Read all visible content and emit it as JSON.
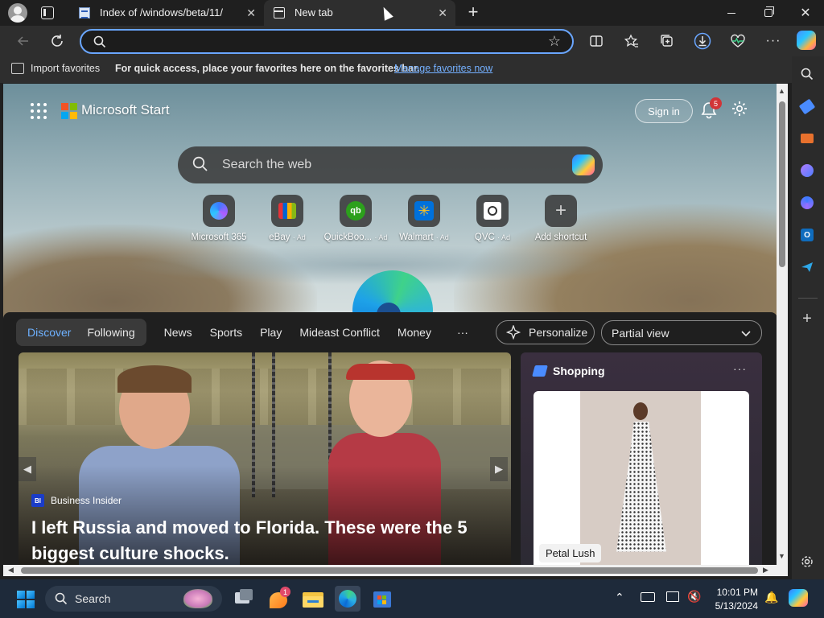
{
  "tabs": [
    {
      "title": "Index of /windows/beta/11/",
      "active": false
    },
    {
      "title": "New tab",
      "active": true
    }
  ],
  "address": {
    "value": "",
    "placeholder": ""
  },
  "favorites_bar": {
    "import_label": "Import favorites",
    "hint": "For quick access, place your favorites here on the favorites bar.",
    "manage_link": "Manage favorites now"
  },
  "page": {
    "brand": "Microsoft Start",
    "sign_in": "Sign in",
    "notification_count": "5",
    "search_placeholder": "Search the web",
    "shortcuts": [
      {
        "label": "Microsoft 365",
        "ad": ""
      },
      {
        "label": "eBay",
        "ad": "· Ad"
      },
      {
        "label": "QuickBoo...",
        "ad": "· Ad"
      },
      {
        "label": "Walmart",
        "ad": "· Ad"
      },
      {
        "label": "QVC",
        "ad": "· Ad"
      },
      {
        "label": "Add shortcut",
        "ad": ""
      }
    ],
    "feed": {
      "pills": [
        "Discover",
        "Following"
      ],
      "tabs": [
        "News",
        "Sports",
        "Play",
        "Mideast Conflict",
        "Money"
      ],
      "more": "···",
      "personalize": "Personalize",
      "view": "Partial view",
      "hero": {
        "source": "Business Insider",
        "source_badge": "BI",
        "headline": "I left Russia and moved to Florida. These were the 5 biggest culture shocks."
      },
      "shopping": {
        "title": "Shopping",
        "more": "···",
        "product_label": "Petal Lush"
      }
    }
  },
  "taskbar": {
    "search_label": "Search",
    "notification_badge": "1",
    "time": "10:01 PM",
    "date": "5/13/2024"
  },
  "colors": {
    "accent": "#6aa6ff",
    "link": "#74b0ff",
    "active_pill": "#6eb1ff",
    "badge": "#d13438"
  }
}
